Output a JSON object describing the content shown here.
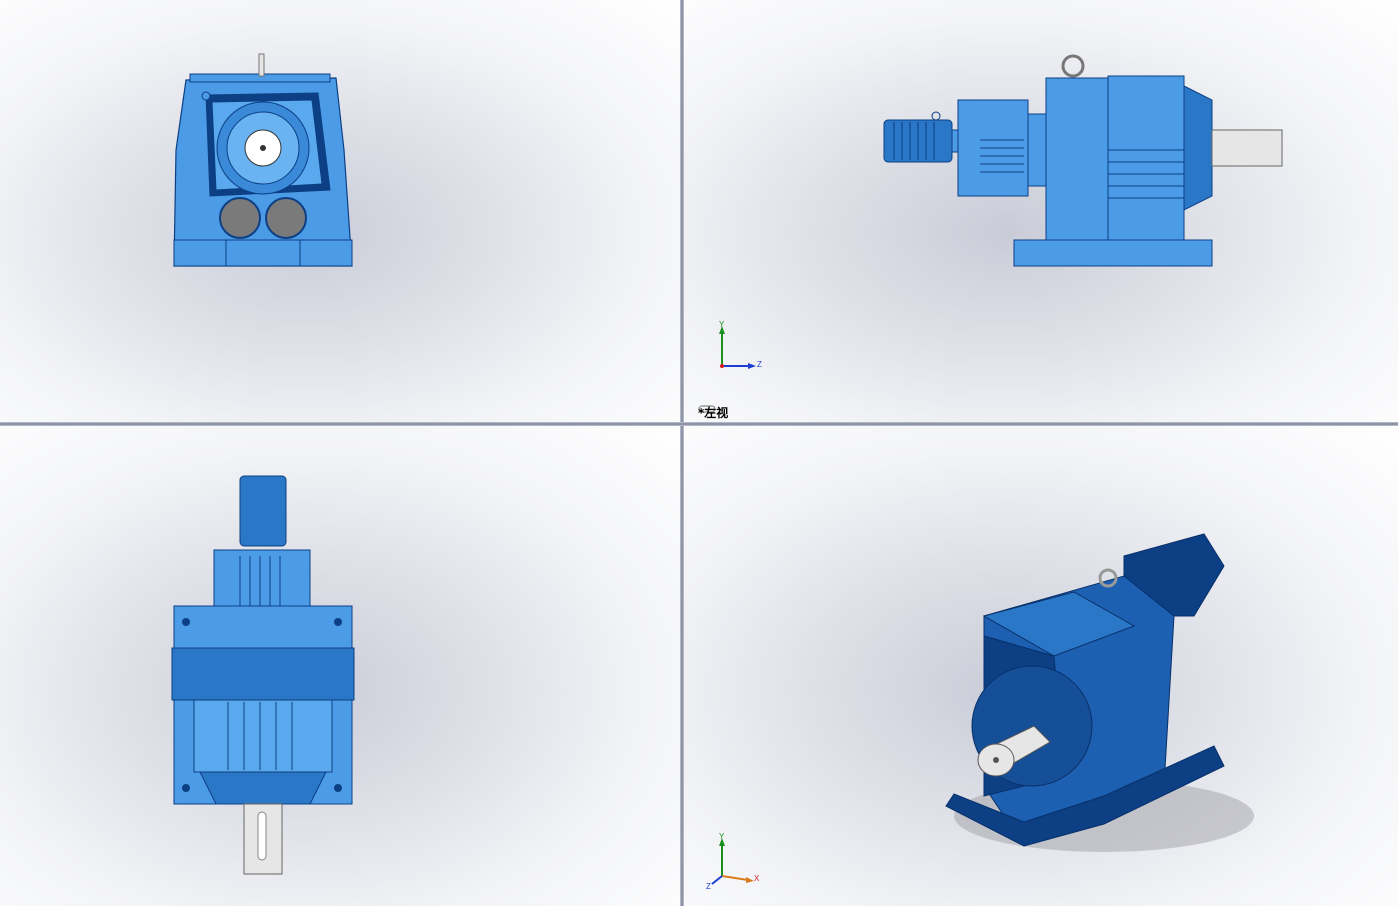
{
  "viewports": {
    "top_left": {
      "name": "front"
    },
    "top_right": {
      "name": "left",
      "label": "*左视",
      "link_icon": "link-icon"
    },
    "bottom_left": {
      "name": "top"
    },
    "bottom_right": {
      "name": "isometric"
    }
  },
  "triads": {
    "left_view": {
      "y": "Y",
      "z": "Z"
    },
    "iso_view": {
      "y": "Y",
      "x": "X",
      "z": "Z"
    }
  },
  "colors": {
    "part_light": "#4c9be6",
    "part_mid": "#2a77c8",
    "part_dark": "#0c3f84",
    "shaft": "#e6e6e6",
    "hole": "#7a7a7a",
    "axis_y": "#1c8f1c",
    "axis_z": "#1b3fd1",
    "axis_x": "#d11b1b"
  }
}
